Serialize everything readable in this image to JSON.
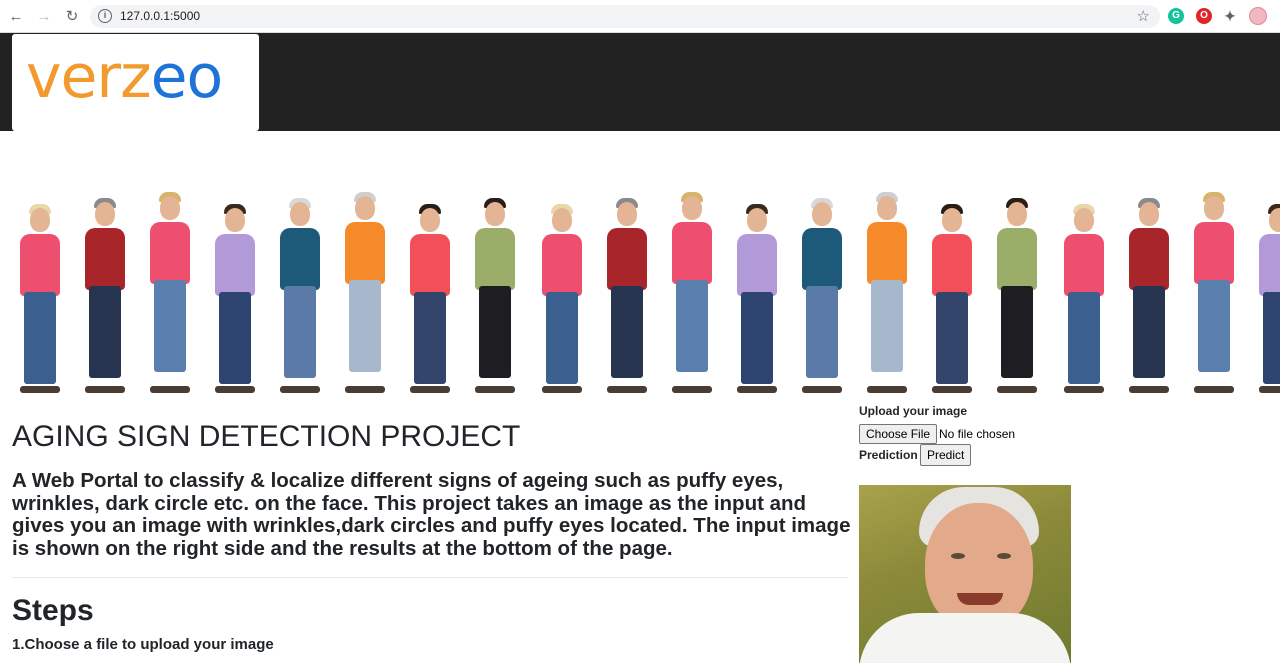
{
  "browser": {
    "url": "127.0.0.1:5000",
    "back_icon": "arrow-left-icon",
    "forward_icon": "arrow-right-icon",
    "reload_icon": "reload-icon"
  },
  "navbar": {
    "logo_left": "verz",
    "logo_right": "eo",
    "background": "#222222"
  },
  "main": {
    "title": "AGING SIGN DETECTION PROJECT",
    "description": "A Web Portal to classify & localize different signs of ageing such as puffy eyes, wrinkles, dark circle etc. on the face. This project takes an image as the input and gives you an image with wrinkles,dark circles and puffy eyes located. The input image is shown on the right side and the results at the bottom of the page.",
    "steps_title": "Steps",
    "step1": "1.Choose a file to upload your image"
  },
  "sidebar": {
    "upload_label": "Upload your image",
    "choose_file_label": "Choose File",
    "file_status": "No file chosen",
    "prediction_label": "Prediction",
    "predict_label": "Predict"
  },
  "colors": {
    "logo_orange": "#f29a2e",
    "logo_blue": "#1e73d8"
  }
}
